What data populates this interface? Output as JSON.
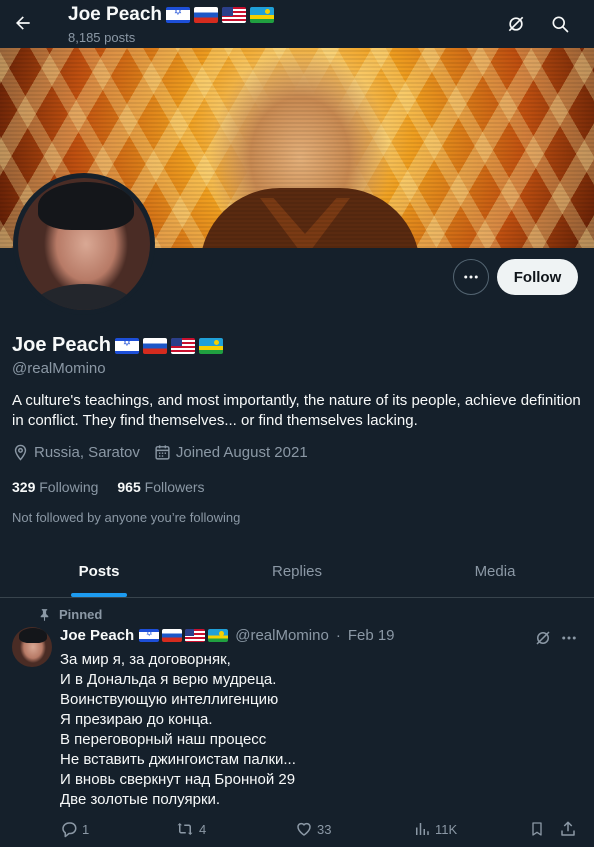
{
  "header": {
    "name": "Joe Peach",
    "posts": "8,185 posts",
    "flags": [
      "flag-israel",
      "flag-russia",
      "flag-usa",
      "flag-rwanda"
    ]
  },
  "profile": {
    "name": "Joe Peach",
    "handle": "@realMomino",
    "bio": "A culture's teachings, and most importantly, the nature of its people, achieve definition in conflict. They find themselves... or find themselves lacking.",
    "location": "Russia, Saratov",
    "joined": "Joined August 2021",
    "following_count": "329",
    "following_label": "Following",
    "followers_count": "965",
    "followers_label": "Followers",
    "not_followed": "Not followed by anyone you’re following",
    "follow_label": "Follow"
  },
  "tabs": [
    {
      "label": "Posts",
      "active": true
    },
    {
      "label": "Replies",
      "active": false
    },
    {
      "label": "Media",
      "active": false
    }
  ],
  "tweet": {
    "pinned_label": "Pinned",
    "name": "Joe Peach",
    "handle": "@realMomino",
    "separator": "·",
    "date": "Feb 19",
    "lines": [
      "За мир я, за договорняк,",
      "И в Дональда я верю мудреца.",
      "Воинствующую интеллигенцию",
      "Я презираю до конца.",
      "В переговорный наш процесс",
      "Не вставить джингоистам палки...",
      "И вновь сверкнут над Бронной 29",
      "Две золотые полуярки."
    ],
    "replies": "1",
    "reposts": "4",
    "likes": "33",
    "views": "11K"
  },
  "colors": {
    "background": "#15202b",
    "accent": "#1d9bf0",
    "text_secondary": "#8b98a5",
    "follow_button_bg": "#eff3f4"
  },
  "icons": [
    "back-arrow-icon",
    "grok-icon",
    "search-icon",
    "more-icon",
    "location-icon",
    "calendar-icon",
    "pin-icon",
    "reply-icon",
    "repost-icon",
    "like-icon",
    "views-icon",
    "bookmark-icon",
    "share-icon"
  ]
}
